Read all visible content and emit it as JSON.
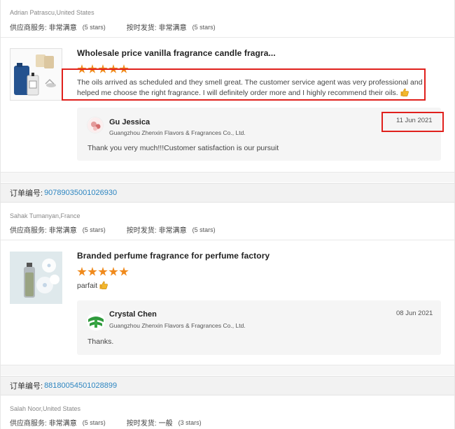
{
  "review1": {
    "author": "Adrian Patrascu,United States",
    "supplier_service_label": "供应商服务:",
    "supplier_service_value": "非常满意",
    "supplier_service_stars": "(5 stars)",
    "shipping_label": "按时发货:",
    "shipping_value": "非常满意",
    "shipping_stars": "(5 stars)",
    "product_title": "Wholesale price vanilla fragrance candle fragra...",
    "rating": 5,
    "text": "The oils arrived as scheduled and they smell great. The customer service agent was very professional and helped me choose the right fragrance. I will definitely order more and I highly recommend their oils.",
    "reply": {
      "name": "Gu Jessica",
      "company": "Guangzhou Zhenxin Flavors & Fragrances Co., Ltd.",
      "date": "11 Jun 2021",
      "text": "Thank you very much!!!Customer satisfaction is our pursuit"
    }
  },
  "order2": {
    "label": "订单编号:",
    "number": "90789035001026930"
  },
  "review2": {
    "author": "Sahak Tumanyan,France",
    "supplier_service_label": "供应商服务:",
    "supplier_service_value": "非常满意",
    "supplier_service_stars": "(5 stars)",
    "shipping_label": "按时发货:",
    "shipping_value": "非常满意",
    "shipping_stars": "(5 stars)",
    "product_title": "Branded perfume fragrance for perfume factory",
    "rating": 5,
    "text": "parfait",
    "reply": {
      "name": "Crystal Chen",
      "company": "Guangzhou Zhenxin Flavors & Fragrances Co., Ltd.",
      "date": "08 Jun 2021",
      "text": "Thanks."
    }
  },
  "order3": {
    "label": "订单编号:",
    "number": "88180054501028899"
  },
  "review3": {
    "author": "Salah Noor,United States",
    "supplier_service_label": "供应商服务:",
    "supplier_service_value": "非常满意",
    "supplier_service_stars": "(5 stars)",
    "shipping_label": "按时发货:",
    "shipping_value": "一般",
    "shipping_stars": "(3 stars)"
  },
  "colors": {
    "star": "#f08a1c",
    "link": "#2e86c1",
    "highlight": "#e0201c"
  }
}
